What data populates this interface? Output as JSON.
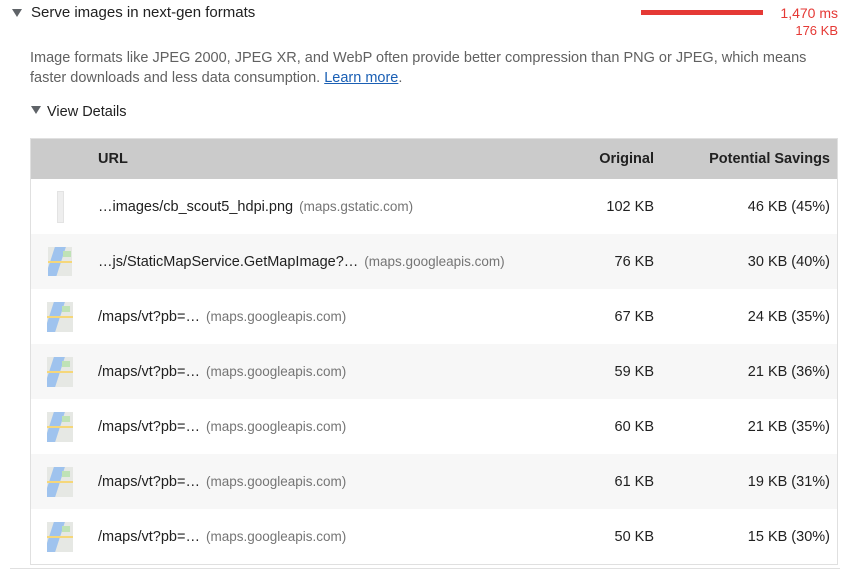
{
  "audit": {
    "title": "Serve images in next-gen formats",
    "metric_ms": "1,470 ms",
    "metric_kb": "176 KB",
    "bar_color": "#e53935",
    "description_text": "Image formats like JPEG 2000, JPEG XR, and WebP often provide better compression than PNG or JPEG, which means faster downloads and less data consumption.",
    "learn_more": "Learn more",
    "details_label": "View Details"
  },
  "table": {
    "headers": {
      "url": "URL",
      "original": "Original",
      "savings": "Potential Savings"
    },
    "rows": [
      {
        "thumb": "png-icon",
        "url": "…images/cb_scout5_hdpi.png",
        "host": "(maps.gstatic.com)",
        "original": "102 KB",
        "savings": "46 KB (45%)"
      },
      {
        "thumb": "map-thumbnail",
        "url": "…js/StaticMapService.GetMapImage?…",
        "host": "(maps.googleapis.com)",
        "original": "76 KB",
        "savings": "30 KB (40%)"
      },
      {
        "thumb": "map-thumbnail",
        "url": "/maps/vt?pb=…",
        "host": "(maps.googleapis.com)",
        "original": "67 KB",
        "savings": "24 KB (35%)"
      },
      {
        "thumb": "map-thumbnail",
        "url": "/maps/vt?pb=…",
        "host": "(maps.googleapis.com)",
        "original": "59 KB",
        "savings": "21 KB (36%)"
      },
      {
        "thumb": "map-thumbnail",
        "url": "/maps/vt?pb=…",
        "host": "(maps.googleapis.com)",
        "original": "60 KB",
        "savings": "21 KB (35%)"
      },
      {
        "thumb": "map-thumbnail",
        "url": "/maps/vt?pb=…",
        "host": "(maps.googleapis.com)",
        "original": "61 KB",
        "savings": "19 KB (31%)"
      },
      {
        "thumb": "map-thumbnail",
        "url": "/maps/vt?pb=…",
        "host": "(maps.googleapis.com)",
        "original": "50 KB",
        "savings": "15 KB (30%)"
      }
    ]
  }
}
